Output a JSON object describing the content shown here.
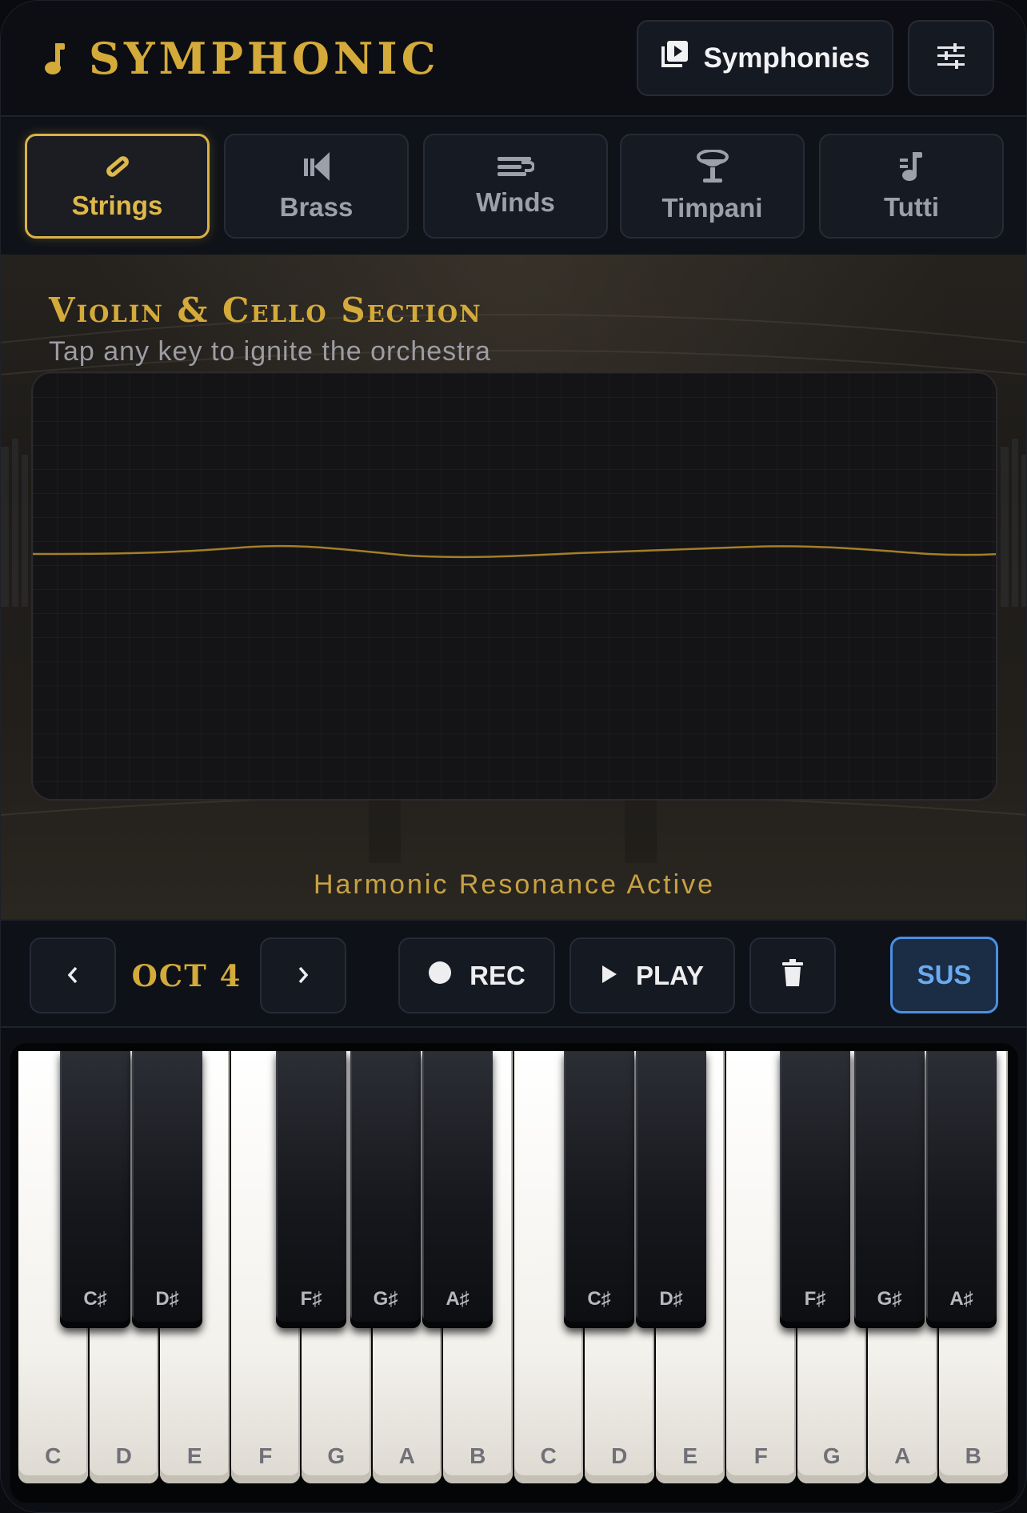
{
  "app": {
    "title": "SYMPHONIC",
    "accent_color": "#d4aa3a",
    "logo_icon": "music-note-icon"
  },
  "header": {
    "symphonies_label": "Symphonies",
    "symphonies_icon": "playlist-play-icon",
    "settings_icon": "sliders-icon"
  },
  "tabs": [
    {
      "label": "Strings",
      "icon": "violin-bow-icon",
      "active": true
    },
    {
      "label": "Brass",
      "icon": "horn-icon",
      "active": false
    },
    {
      "label": "Winds",
      "icon": "flute-icon",
      "active": false
    },
    {
      "label": "Timpani",
      "icon": "drum-icon",
      "active": false
    },
    {
      "label": "Tutti",
      "icon": "music-notes-icon",
      "active": false
    }
  ],
  "section": {
    "title": "Violin & Cello Section",
    "subtitle": "Tap any key to ignite the orchestra",
    "status": "Harmonic Resonance Active",
    "wave_color": "#c79a2a"
  },
  "controls": {
    "octave_label": "OCT 4",
    "rec_label": "REC",
    "play_label": "PLAY",
    "sus_label": "SUS",
    "sus_active": true,
    "sus_color": "#4a90e2"
  },
  "keyboard": {
    "white_keys": [
      "C",
      "D",
      "E",
      "F",
      "G",
      "A",
      "B",
      "C",
      "D",
      "E",
      "F",
      "G",
      "A",
      "B"
    ],
    "black_keys": [
      "C♯",
      "D♯",
      "F♯",
      "G♯",
      "A♯",
      "C♯",
      "D♯",
      "F♯",
      "G♯",
      "A♯"
    ]
  }
}
